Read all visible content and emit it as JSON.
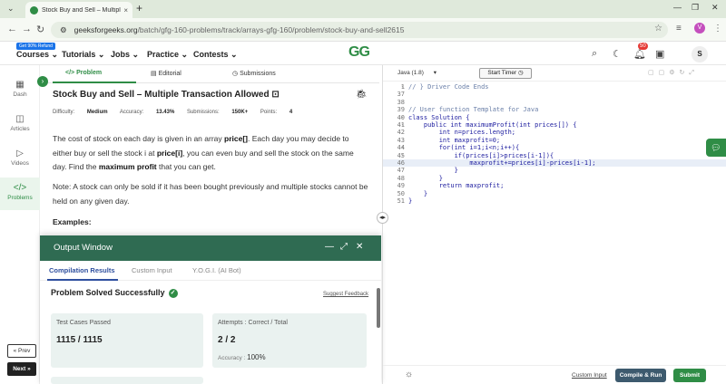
{
  "browser": {
    "tab_title": "Stock Buy and Sell – Multiple Tr...",
    "tab_close": "×",
    "new_tab": "+",
    "url_site": "geeksforgeeks.org",
    "url_path": "/batch/gfg-160-problems/track/arrays-gfg-160/problem/stock-buy-and-sell2615",
    "profile_letter": "V"
  },
  "header": {
    "refund_badge": "Get 90% Refund",
    "nav": [
      "Courses",
      "Tutorials",
      "Jobs",
      "Practice",
      "Contests"
    ],
    "logo": "GG",
    "notifications_count": "50",
    "avatar_letter": "S"
  },
  "rail": {
    "items": [
      "Dash",
      "Articles",
      "Videos",
      "Problems"
    ],
    "prev": "« Prev",
    "next": "Next »"
  },
  "problem": {
    "tabs": [
      "Problem",
      "Editorial",
      "Submissions"
    ],
    "title": "Stock Buy and Sell – Multiple Transaction Allowed",
    "difficulty_label": "Difficulty:",
    "difficulty": "Medium",
    "accuracy_label": "Accuracy:",
    "accuracy": "13.43%",
    "submissions_label": "Submissions:",
    "submissions": "150K+",
    "points_label": "Points:",
    "points": "4",
    "para1_a": "The cost of stock on each day is given in an array ",
    "para1_b": "price[]",
    "para1_c": ". Each day you may decide to either buy or sell the stock i at ",
    "para1_d": "price[i]",
    "para1_e": ", you can even buy and sell the stock on the same day. Find the ",
    "para1_f": "maximum profit",
    "para1_g": " that you can get.",
    "para2": "Note: A stock can only be sold if it has been bought previously and multiple stocks cannot be held on any given day.",
    "examples": "Examples:"
  },
  "output": {
    "title": "Output Window",
    "tabs": [
      "Compilation Results",
      "Custom Input",
      "Y.O.G.I. (AI Bot)"
    ],
    "status": "Problem Solved Successfully",
    "suggest": "Suggest Feedback",
    "tests_label": "Test Cases Passed",
    "tests_value": "1115 / 1115",
    "attempts_label": "Attempts : Correct / Total",
    "attempts_value": "2 / 2",
    "accuracy_label": "Accuracy :",
    "accuracy_value": "100%"
  },
  "editor": {
    "language": "Java (1.8)",
    "timer": "Start Timer",
    "lines": [
      {
        "n": "1",
        "t": "// } Driver Code Ends"
      },
      {
        "n": "37",
        "t": ""
      },
      {
        "n": "38",
        "t": ""
      },
      {
        "n": "39",
        "t": "// User function Template for Java"
      },
      {
        "n": "40",
        "t": "class Solution {"
      },
      {
        "n": "41",
        "t": "    public int maximumProfit(int prices[]) {"
      },
      {
        "n": "42",
        "t": "        int n=prices.length;"
      },
      {
        "n": "43",
        "t": "        int maxprofit=0;"
      },
      {
        "n": "44",
        "t": "        for(int i=1;i<n;i++){"
      },
      {
        "n": "45",
        "t": "            if(prices[i]>prices[i-1]){"
      },
      {
        "n": "46",
        "t": "                maxprofit+=prices[i]-prices[i-1];"
      },
      {
        "n": "47",
        "t": "            }"
      },
      {
        "n": "48",
        "t": "        }"
      },
      {
        "n": "49",
        "t": "        return maxprofit;"
      },
      {
        "n": "50",
        "t": "    }"
      },
      {
        "n": "51",
        "t": "}"
      }
    ],
    "custom_input": "Custom Input",
    "compile": "Compile & Run",
    "submit": "Submit"
  }
}
